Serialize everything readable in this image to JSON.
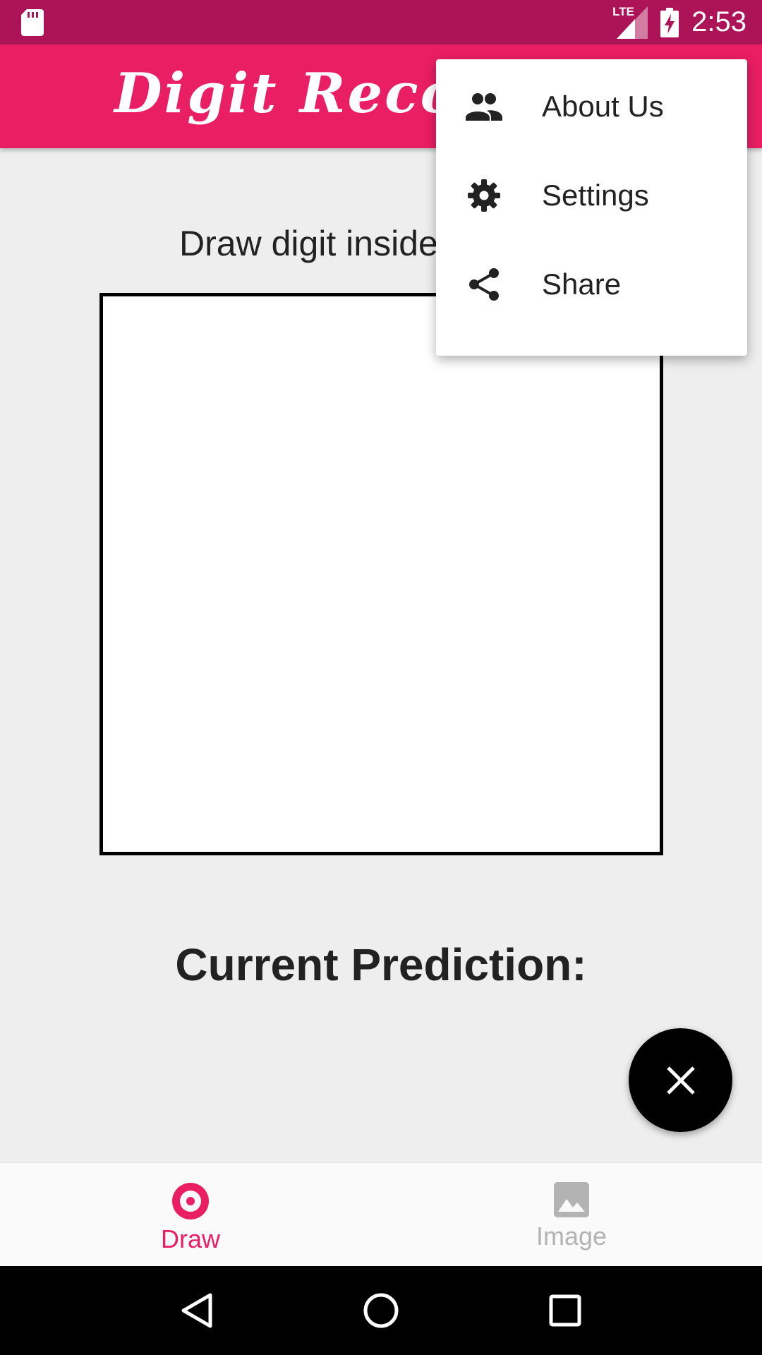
{
  "status_bar": {
    "time": "2:53",
    "network_label": "LTE",
    "icons": [
      "sd-card-icon",
      "signal-icon",
      "battery-charging-icon"
    ]
  },
  "app_bar": {
    "title": "Digit Recognizer"
  },
  "main": {
    "instruction": "Draw digit inside",
    "prediction_label": "Current Prediction:"
  },
  "fab": {
    "icon": "close-icon"
  },
  "bottom_nav": {
    "items": [
      {
        "label": "Draw",
        "icon": "draw-icon",
        "active": true
      },
      {
        "label": "Image",
        "icon": "image-icon",
        "active": false
      }
    ]
  },
  "menu": {
    "items": [
      {
        "label": "About Us",
        "icon": "people-icon"
      },
      {
        "label": "Settings",
        "icon": "gear-icon"
      },
      {
        "label": "Share",
        "icon": "share-icon"
      }
    ]
  },
  "colors": {
    "status_bar": "#ad1457",
    "app_bar": "#e91e63",
    "accent": "#e91e63",
    "inactive": "#b3b3b3"
  }
}
